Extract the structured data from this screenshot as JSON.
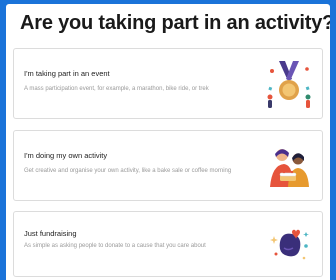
{
  "page": {
    "title": "Are you taking part in an activity?"
  },
  "options": [
    {
      "title": "I'm taking part in an event",
      "description": "A mass participation event, for example, a marathon, bike ride, or trek",
      "icon": "medal-icon"
    },
    {
      "title": "I'm doing my own activity",
      "description": "Get creative and organise your own activity, like a bake sale or coffee morning",
      "icon": "people-baking-icon"
    },
    {
      "title": "Just fundraising",
      "description": "As simple as asking people to donate to a cause that you care about",
      "icon": "donation-icon"
    }
  ],
  "colors": {
    "background": "#1a73d9",
    "card_border": "#dcdcdc",
    "title_text": "#1a1a1a",
    "description_text": "#9a9a9a"
  }
}
